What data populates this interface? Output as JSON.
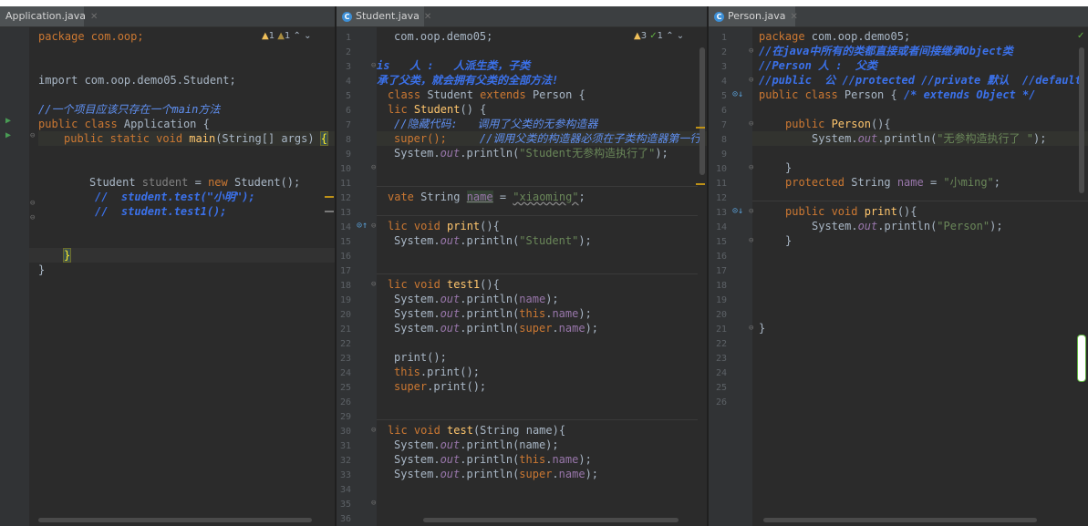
{
  "tabs": {
    "left": "Application.java",
    "middle": "Student.java",
    "right": "Person.java"
  },
  "inspection": {
    "left": {
      "warnings": "1",
      "weak_warnings": "1"
    },
    "middle": {
      "warnings": "3",
      "ok": "1"
    }
  },
  "icons": {
    "tab": "class-icon",
    "close": "close-icon",
    "run": "run-arrow-icon",
    "override": "override-icon",
    "implemented": "implemented-icon"
  },
  "colors": {
    "background": "#2b2b2b",
    "keyword": "#cc7832",
    "string": "#6a8759",
    "comment": "#5f8ff0",
    "function": "#ffc66d"
  },
  "left": {
    "lines": [
      "package com.oop;",
      "import com.oop.demo05.Student;",
      "//一个项目应该只存在一个main方法",
      "public class Application {",
      "public static void main(String[] args) {",
      "Student student = new Student();",
      "//  student.test(\"小明\");",
      "//  student.test1();",
      "}",
      "}"
    ]
  },
  "middle": {
    "line_numbers": [
      "1",
      "2",
      "3",
      "4",
      "5",
      "6",
      "7",
      "8",
      "9",
      "10",
      "11",
      "12",
      "13",
      "14",
      "15",
      "16",
      "17",
      "18",
      "19",
      "20",
      "21",
      "22",
      "23",
      "24",
      "25",
      "26",
      "29",
      "30",
      "31",
      "32",
      "33",
      "34",
      "35",
      "36"
    ],
    "lines": {
      "l1": "com.oop.demo05;",
      "l3": "is   人 :   人派生类，子类",
      "l4": "承了父类，就会拥有父类的全部方法!",
      "l5": "class Student extends Person {",
      "l6": "lic Student() {",
      "l7": "//隐藏代码:   调用了父类的无参构造器",
      "l8a": "super();",
      "l8b": "//调用父类的构造器必须在子类构造器第一行",
      "l9": "System.out.println(\"Student无参构造执行了\");",
      "l12": "vate String name = \"xiaoming\";",
      "l14": "lic void print(){",
      "l15": "System.out.println(\"Student\");",
      "l18": "lic void test1(){",
      "l19": "System.out.println(name);",
      "l20": "System.out.println(this.name);",
      "l21": "System.out.println(super.name);",
      "l23": "print();",
      "l24": "this.print();",
      "l25": "super.print();",
      "l30": "lic void test(String name){",
      "l31": "System.out.println(name);",
      "l32": "System.out.println(this.name);",
      "l33": "System.out.println(super.name);"
    }
  },
  "right": {
    "line_numbers": [
      "1",
      "2",
      "3",
      "4",
      "5",
      "6",
      "7",
      "8",
      "9",
      "10",
      "11",
      "12",
      "13",
      "14",
      "15",
      "16",
      "17",
      "18",
      "19",
      "20",
      "21",
      "22",
      "23",
      "24",
      "25",
      "26"
    ],
    "lines": {
      "l1": "package com.oop.demo05;",
      "l2": "//在java中所有的类都直接或者间接继承Object类",
      "l3": "//Person 人 :  父类",
      "l4": "//public  公 //protected //private 默认  //default",
      "l5": "public class Person { /* extends Object */",
      "l7": "public Person(){",
      "l8": "System.out.println(\"无参构造执行了 \");",
      "l10": "}",
      "l11": "protected String name = \"小ming\";",
      "l13": "public void print(){",
      "l14": "System.out.println(\"Person\");",
      "l15": "}",
      "l21": "}"
    }
  }
}
